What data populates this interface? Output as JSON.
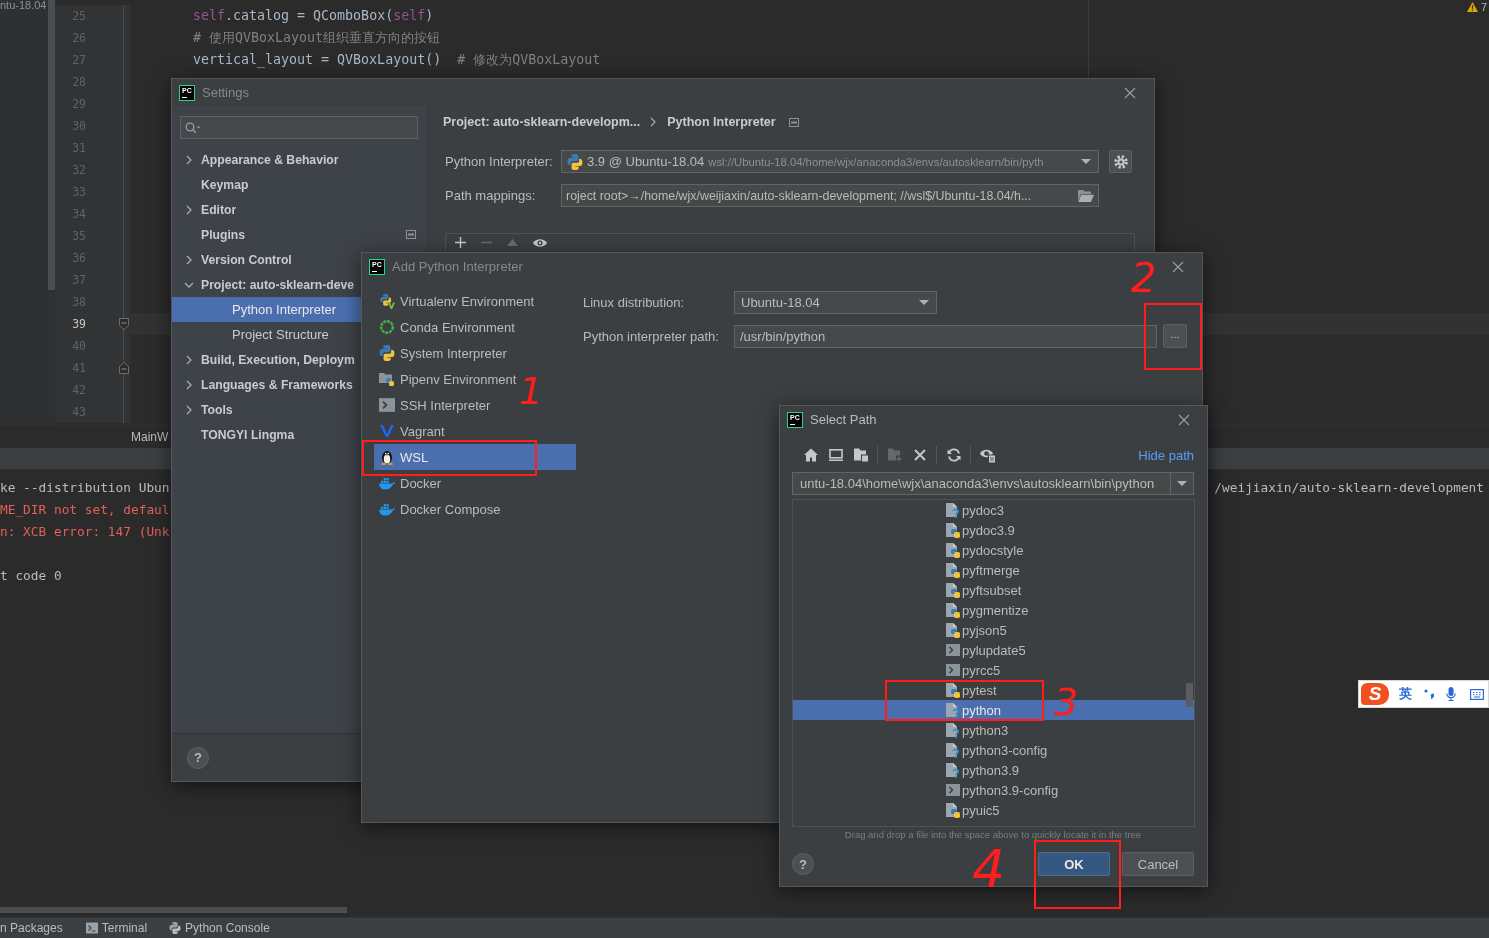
{
  "editor": {
    "tab_fragment": "ntu-18.04",
    "warning_count": "7",
    "breadcrumb": "MainW",
    "lines": [
      {
        "number": "25",
        "kind": "plain",
        "current": false,
        "code": [
          {
            "text": "self",
            "kind": "self"
          },
          {
            "text": ".catalog = QComboBox(",
            "kind": "plain"
          },
          {
            "text": "self",
            "kind": "self"
          },
          {
            "text": ")",
            "kind": "plain"
          }
        ]
      },
      {
        "number": "26",
        "kind": "plain",
        "current": false,
        "code": [
          {
            "text": "# 使用QVBoxLayout组织垂直方向的按钮",
            "kind": "comment"
          }
        ]
      },
      {
        "number": "27",
        "kind": "plain",
        "current": false,
        "code": [
          {
            "text": "vertical_layout = QVBoxLayout()",
            "kind": "plain"
          },
          {
            "text": "  # 修改为QVBoxLayout",
            "kind": "comment"
          }
        ]
      },
      {
        "number": "28",
        "kind": "plain",
        "current": false
      },
      {
        "number": "29",
        "kind": "plain",
        "current": false
      },
      {
        "number": "30",
        "kind": "plain",
        "current": false
      },
      {
        "number": "31",
        "kind": "plain",
        "current": false
      },
      {
        "number": "32",
        "kind": "plain",
        "current": false
      },
      {
        "number": "33",
        "kind": "plain",
        "current": false
      },
      {
        "number": "34",
        "kind": "plain",
        "current": false
      },
      {
        "number": "35",
        "kind": "plain",
        "current": false
      },
      {
        "number": "36",
        "kind": "plain",
        "current": false
      },
      {
        "number": "37",
        "kind": "plain",
        "current": false
      },
      {
        "number": "38",
        "kind": "plain",
        "current": false
      },
      {
        "number": "39",
        "kind": "fold_start",
        "current": true
      },
      {
        "number": "40",
        "kind": "plain",
        "current": false
      },
      {
        "number": "41",
        "kind": "fold_end",
        "current": false
      },
      {
        "number": "42",
        "kind": "plain",
        "current": false
      },
      {
        "number": "43",
        "kind": "plain",
        "current": false
      }
    ]
  },
  "terminal": {
    "lines": [
      {
        "text": "ke --distribution Ubun",
        "kind": "output"
      },
      {
        "text": "ME_DIR not set, defaul",
        "kind": "error"
      },
      {
        "text": "n: XCB error: 147 (Unk",
        "kind": "error"
      },
      {
        "text": "t code 0",
        "kind": "output"
      }
    ],
    "right_fragment": "/weijiaxin/auto-sklearn-development"
  },
  "tool_windows": [
    {
      "label": "n Packages",
      "kind": "plain"
    },
    {
      "label": "Terminal",
      "kind": "terminal"
    },
    {
      "label": "Python Console",
      "kind": "python"
    }
  ],
  "settings": {
    "logo": "PC",
    "title": "Settings",
    "sidebar": [
      {
        "label": "Appearance & Behavior",
        "expanded": false,
        "selected": false
      },
      {
        "label": "Keymap",
        "selected": false
      },
      {
        "label": "Editor",
        "expanded": false,
        "selected": false
      },
      {
        "label": "Plugins",
        "selected": false,
        "page_icon": true
      },
      {
        "label": "Version Control",
        "expanded": false,
        "selected": false
      },
      {
        "label": "Project: auto-sklearn-deve",
        "expanded": true,
        "selected": false,
        "children": [
          {
            "label": "Python Interpreter",
            "selected": true
          },
          {
            "label": "Project Structure",
            "selected": false
          }
        ]
      },
      {
        "label": "Build, Execution, Deploym",
        "expanded": false,
        "selected": false
      },
      {
        "label": "Languages & Frameworks",
        "expanded": false,
        "selected": false
      },
      {
        "label": "Tools",
        "expanded": false,
        "selected": false
      },
      {
        "label": "TONGYI Lingma",
        "selected": false
      }
    ],
    "breadcrumb": [
      "Project: auto-sklearn-developm...",
      "Python Interpreter"
    ],
    "interpreter": {
      "label": "Python Interpreter:",
      "version": "3.9 @ Ubuntu-18.04",
      "path": "wsl://Ubuntu-18.04/home/wjx/anaconda3/envs/autosklearn/bin/pyth"
    },
    "path_mappings": {
      "label": "Path mappings:",
      "value": "roject root>→/home/wjx/weijiaxin/auto-sklearn-development; //wsl$/Ubuntu-18.04/h..."
    },
    "table_toolbar": [
      {
        "kind": "add",
        "disabled": false
      },
      {
        "kind": "remove",
        "disabled": true
      },
      {
        "kind": "up",
        "disabled": true
      },
      {
        "kind": "show",
        "disabled": false
      }
    ],
    "help": "?"
  },
  "add_interpreter": {
    "logo": "PC",
    "title": "Add Python Interpreter",
    "types": [
      {
        "label": "Virtualenv Environment",
        "kind": "virtualenv",
        "selected": false
      },
      {
        "label": "Conda Environment",
        "kind": "conda",
        "selected": false
      },
      {
        "label": "System Interpreter",
        "kind": "python",
        "selected": false
      },
      {
        "label": "Pipenv Environment",
        "kind": "pipenv",
        "selected": false
      },
      {
        "label": "SSH Interpreter",
        "kind": "ssh",
        "selected": false
      },
      {
        "label": "Vagrant",
        "kind": "vagrant",
        "selected": false
      },
      {
        "label": "WSL",
        "kind": "linux",
        "selected": true
      },
      {
        "label": "Docker",
        "kind": "docker",
        "selected": false
      },
      {
        "label": "Docker Compose",
        "kind": "docker",
        "selected": false
      }
    ],
    "distribution": {
      "label": "Linux distribution:",
      "value": "Ubuntu-18.04"
    },
    "interpreter_path": {
      "label": "Python interpreter path:",
      "value": "/usr/bin/python",
      "browse": "..."
    }
  },
  "select_path": {
    "logo": "PC",
    "title": "Select Path",
    "toolbar_groups": [
      [
        {
          "kind": "home",
          "disabled": false
        },
        {
          "kind": "desktop",
          "disabled": false
        },
        {
          "kind": "project",
          "disabled": false
        }
      ],
      [
        {
          "kind": "new_folder",
          "disabled": true
        },
        {
          "kind": "delete",
          "disabled": false
        }
      ],
      [
        {
          "kind": "refresh",
          "disabled": false
        }
      ],
      [
        {
          "kind": "show_hidden",
          "disabled": false
        }
      ]
    ],
    "hide_path": "Hide path",
    "path": "untu-18.04\\home\\wjx\\anaconda3\\envs\\autosklearn\\bin\\python",
    "files": [
      {
        "name": "pydoc3",
        "kind": "unknown",
        "selected": false
      },
      {
        "name": "pydoc3.9",
        "kind": "python",
        "selected": false
      },
      {
        "name": "pydocstyle",
        "kind": "python",
        "selected": false
      },
      {
        "name": "pyftmerge",
        "kind": "python",
        "selected": false
      },
      {
        "name": "pyftsubset",
        "kind": "python",
        "selected": false
      },
      {
        "name": "pygmentize",
        "kind": "python",
        "selected": false
      },
      {
        "name": "pyjson5",
        "kind": "python",
        "selected": false
      },
      {
        "name": "pylupdate5",
        "kind": "exec",
        "selected": false
      },
      {
        "name": "pyrcc5",
        "kind": "exec",
        "selected": false
      },
      {
        "name": "pytest",
        "kind": "python",
        "selected": false
      },
      {
        "name": "python",
        "kind": "unknown",
        "selected": true
      },
      {
        "name": "python3",
        "kind": "unknown",
        "selected": false
      },
      {
        "name": "python3-config",
        "kind": "unknown",
        "selected": false
      },
      {
        "name": "python3.9",
        "kind": "unknown",
        "selected": false
      },
      {
        "name": "python3.9-config",
        "kind": "exec",
        "selected": false
      },
      {
        "name": "pyuic5",
        "kind": "python",
        "selected": false
      }
    ],
    "hint": "Drag and drop a file into the space above to quickly locate it in the tree",
    "help": "?",
    "buttons": [
      {
        "label": "OK",
        "kind": "primary"
      },
      {
        "label": "Cancel",
        "kind": "secondary"
      }
    ]
  },
  "ime_bar": {
    "logo": "S",
    "mode": "英"
  },
  "annotations": [
    {
      "number": "1"
    },
    {
      "number": "2"
    },
    {
      "number": "3"
    },
    {
      "number": "4"
    }
  ]
}
